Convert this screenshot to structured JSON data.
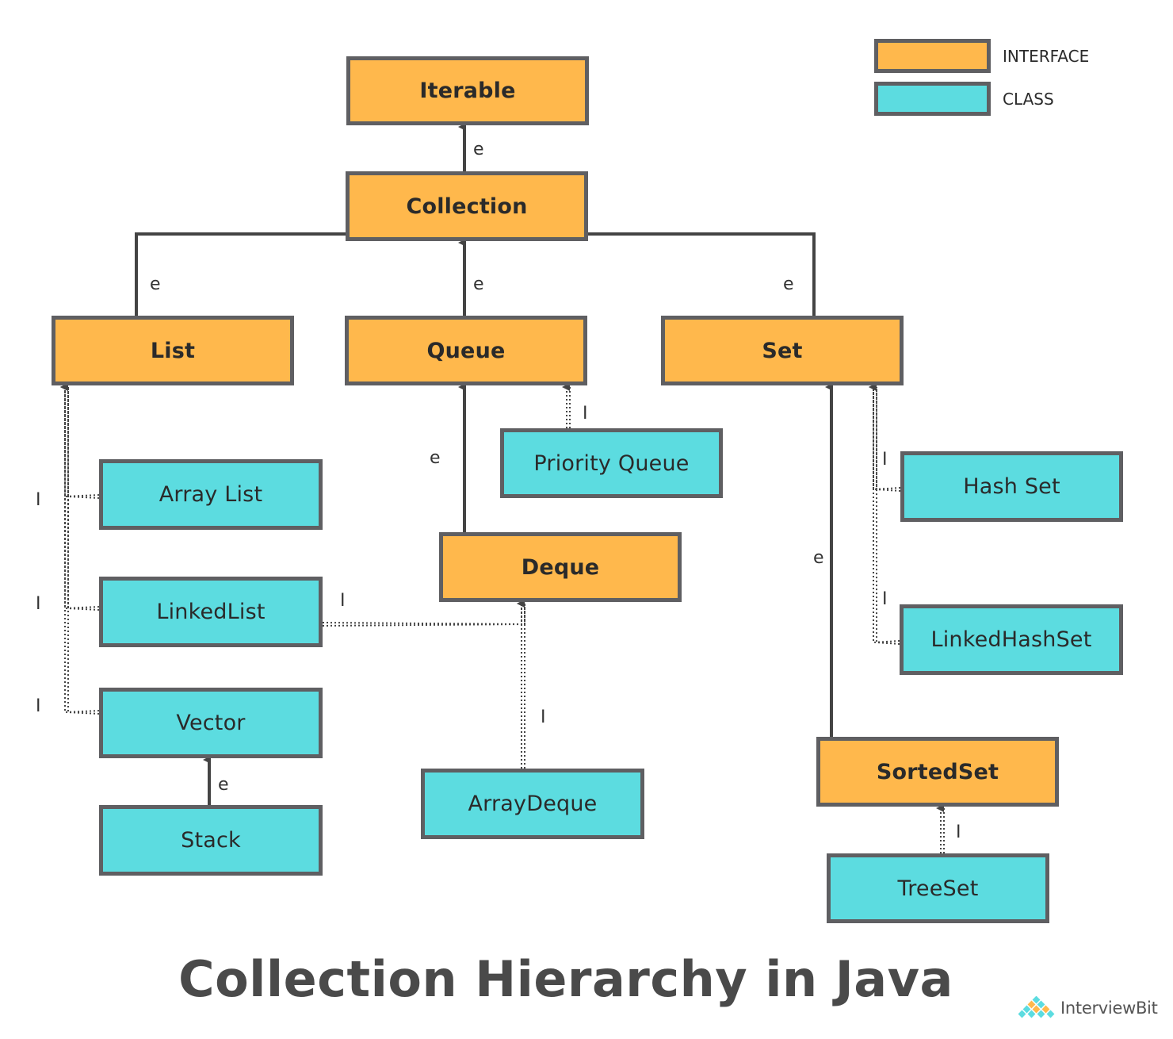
{
  "title": "Collection Hierarchy in Java",
  "brand": {
    "name": "InterviewBit",
    "logo_icon": "pyramid-diamond-logo-icon"
  },
  "colors": {
    "interface": "#ffb84c",
    "class": "#5cdce0",
    "border": "#5f5f62",
    "connector": "#444444",
    "text": "#2a2a2a",
    "title": "#4a4a4a"
  },
  "legend": [
    {
      "type": "interface",
      "label": "INTERFACE"
    },
    {
      "type": "class",
      "label": "CLASS"
    }
  ],
  "relation_labels": {
    "extends": "e",
    "implements": "I"
  },
  "nodes": {
    "iterable": {
      "label": "Iterable",
      "type": "interface"
    },
    "collection": {
      "label": "Collection",
      "type": "interface"
    },
    "list": {
      "label": "List",
      "type": "interface"
    },
    "queue": {
      "label": "Queue",
      "type": "interface"
    },
    "set": {
      "label": "Set",
      "type": "interface"
    },
    "priority_queue": {
      "label": "Priority Queue",
      "type": "class"
    },
    "deque": {
      "label": "Deque",
      "type": "interface"
    },
    "array_list": {
      "label": "Array List",
      "type": "class"
    },
    "linked_list": {
      "label": "LinkedList",
      "type": "class"
    },
    "vector": {
      "label": "Vector",
      "type": "class"
    },
    "stack": {
      "label": "Stack",
      "type": "class"
    },
    "array_deque": {
      "label": "ArrayDeque",
      "type": "class"
    },
    "hash_set": {
      "label": "Hash Set",
      "type": "class"
    },
    "linked_hash_set": {
      "label": "LinkedHashSet",
      "type": "class"
    },
    "sorted_set": {
      "label": "SortedSet",
      "type": "interface"
    },
    "tree_set": {
      "label": "TreeSet",
      "type": "class"
    }
  },
  "edges": [
    {
      "from": "collection",
      "to": "iterable",
      "relation": "extends"
    },
    {
      "from": "list",
      "to": "collection",
      "relation": "extends"
    },
    {
      "from": "queue",
      "to": "collection",
      "relation": "extends"
    },
    {
      "from": "set",
      "to": "collection",
      "relation": "extends"
    },
    {
      "from": "priority_queue",
      "to": "queue",
      "relation": "implements"
    },
    {
      "from": "deque",
      "to": "queue",
      "relation": "extends"
    },
    {
      "from": "array_list",
      "to": "list",
      "relation": "implements"
    },
    {
      "from": "linked_list",
      "to": "list",
      "relation": "implements"
    },
    {
      "from": "vector",
      "to": "list",
      "relation": "implements"
    },
    {
      "from": "stack",
      "to": "vector",
      "relation": "extends"
    },
    {
      "from": "linked_list",
      "to": "deque",
      "relation": "implements"
    },
    {
      "from": "array_deque",
      "to": "deque",
      "relation": "implements"
    },
    {
      "from": "hash_set",
      "to": "set",
      "relation": "implements"
    },
    {
      "from": "linked_hash_set",
      "to": "set",
      "relation": "implements"
    },
    {
      "from": "sorted_set",
      "to": "set",
      "relation": "extends"
    },
    {
      "from": "tree_set",
      "to": "sorted_set",
      "relation": "implements"
    }
  ]
}
